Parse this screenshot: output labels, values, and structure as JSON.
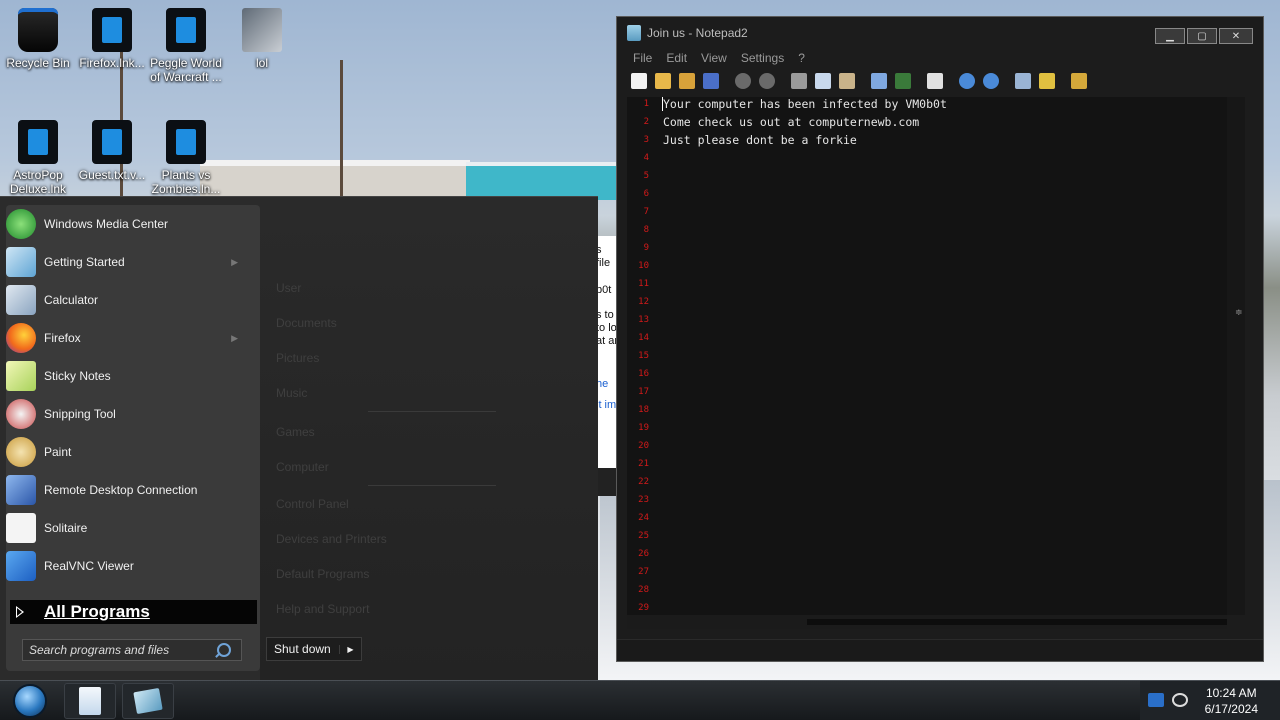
{
  "desktop": {
    "icons": [
      {
        "label": "Recycle Bin",
        "icon": "recycle-bin-icon"
      },
      {
        "label": "Firefox.lnk...",
        "icon": "shortcut-icon"
      },
      {
        "label": "Peggle World of Warcraft ...",
        "icon": "shortcut-icon"
      },
      {
        "label": "lol",
        "icon": "folder-icon"
      },
      {
        "label": "AstroPop Deluxe.lnk",
        "icon": "shortcut-icon"
      },
      {
        "label": "Guest.txt.v...",
        "icon": "shortcut-icon"
      },
      {
        "label": "Plants vs Zombies.ln...",
        "icon": "shortcut-icon"
      }
    ]
  },
  "start_menu": {
    "programs": [
      {
        "label": "Windows Media Center",
        "icon": "media-center-icon",
        "color": "#3aa636",
        "has_arrow": false
      },
      {
        "label": "Getting Started",
        "icon": "getting-started-icon",
        "color": "#7ab6d8",
        "has_arrow": true
      },
      {
        "label": "Calculator",
        "icon": "calculator-icon",
        "color": "#9db7d0",
        "has_arrow": false
      },
      {
        "label": "Firefox",
        "icon": "firefox-icon",
        "color": "#e8661c",
        "has_arrow": true
      },
      {
        "label": "Sticky Notes",
        "icon": "sticky-notes-icon",
        "color": "#c9e08a",
        "has_arrow": false
      },
      {
        "label": "Snipping Tool",
        "icon": "scissors-icon",
        "color": "#c94b4b",
        "has_arrow": false
      },
      {
        "label": "Paint",
        "icon": "paint-icon",
        "color": "#d9b25a",
        "has_arrow": false
      },
      {
        "label": "Remote Desktop Connection",
        "icon": "remote-desktop-icon",
        "color": "#3b6ec2",
        "has_arrow": false
      },
      {
        "label": "Solitaire",
        "icon": "cards-icon",
        "color": "#e8e8e8",
        "has_arrow": false
      },
      {
        "label": "RealVNC Viewer",
        "icon": "vnc-icon",
        "color": "#2f7fd6",
        "has_arrow": false
      }
    ],
    "all_programs": "All Programs",
    "search_placeholder": "Search programs and files",
    "right_links": [
      "User",
      "Documents",
      "Pictures",
      "Music",
      "Games",
      "Computer",
      "Control Panel",
      "Devices and Printers",
      "Default Programs",
      "Help and Support"
    ],
    "shutdown_label": "Shut down"
  },
  "background_window_fragments": [
    "s file",
    "b0t",
    "s to",
    "to lo",
    "at ar",
    "he",
    "it im"
  ],
  "notepad": {
    "title": "Join us - Notepad2",
    "menu": [
      "File",
      "Edit",
      "View",
      "Settings",
      "?"
    ],
    "lines": [
      "Your computer has been infected by VM0b0t",
      "Come check us out at computernewb.com",
      "Just please dont be a forkie"
    ],
    "line_numbers": [
      "1",
      "2",
      "3",
      "4",
      "5",
      "6",
      "7",
      "8",
      "9",
      "10",
      "11",
      "12",
      "13",
      "14",
      "15",
      "16",
      "17",
      "18",
      "19",
      "20",
      "21",
      "22",
      "23",
      "24",
      "25",
      "26",
      "27",
      "28",
      "29"
    ]
  },
  "taskbar": {
    "time": "10:24 AM",
    "date": "6/17/2024"
  }
}
